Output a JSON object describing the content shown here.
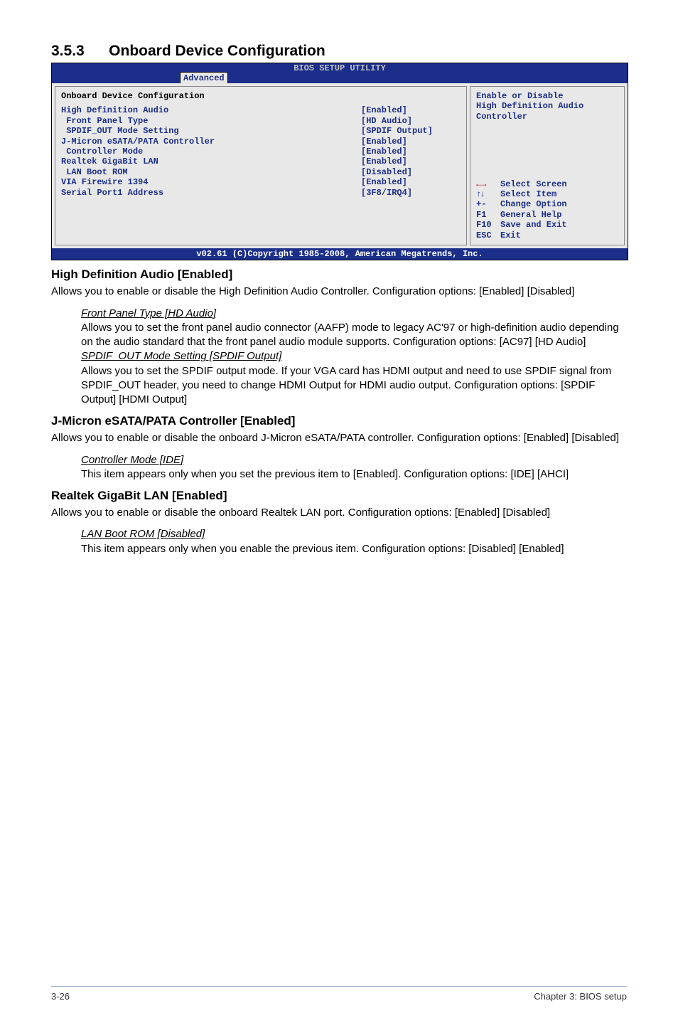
{
  "section": {
    "number": "3.5.3",
    "title": "Onboard Device Configuration"
  },
  "bios": {
    "headerTitle": "BIOS SETUP UTILITY",
    "tab": "Advanced",
    "leftHeading": "Onboard Device Configuration",
    "rows": [
      {
        "k": "High Definition Audio",
        "v": "[Enabled]"
      },
      {
        "k": " Front Panel Type",
        "v": "[HD Audio]"
      },
      {
        "k": " SPDIF_OUT Mode Setting",
        "v": "[SPDIF Output]"
      },
      {
        "k": "J-Micron eSATA/PATA Controller",
        "v": "[Enabled]"
      },
      {
        "k": " Controller Mode",
        "v": "[Enabled]"
      },
      {
        "k": "Realtek GigaBit LAN",
        "v": "[Enabled]"
      },
      {
        "k": " LAN Boot ROM",
        "v": "[Disabled]"
      },
      {
        "k": "VIA Firewire 1394",
        "v": "[Enabled]"
      },
      {
        "k": "",
        "v": ""
      },
      {
        "k": "Serial Port1 Address",
        "v": "[3F8/IRQ4]"
      }
    ],
    "helpTop1": "Enable or Disable",
    "helpTop2": "High Definition Audio",
    "helpTop3": "Controller",
    "helpLines": [
      {
        "sym": "lr",
        "txt": "Select Screen"
      },
      {
        "sym": "ud",
        "txt": "Select Item"
      },
      {
        "sym": "+-",
        "txt": "Change Option"
      },
      {
        "sym": "F1",
        "txt": "General Help"
      },
      {
        "sym": "F10",
        "txt": "Save and Exit"
      },
      {
        "sym": "ESC",
        "txt": "Exit"
      }
    ],
    "footer": "v02.61 (C)Copyright 1985-2008, American Megatrends, Inc."
  },
  "body": {
    "h1": "High Definition Audio [Enabled]",
    "p1": "Allows you to enable or disable the High Definition Audio Controller. Configuration options: [Enabled] [Disabled]",
    "sub1_t": "Front Panel Type [HD Audio]",
    "sub1_p": "Allows you to set the front panel audio connector (AAFP) mode to legacy AC'97 or high-definition audio depending on the audio standard that the front panel audio module supports. Configuration options: [AC97] [HD Audio]",
    "sub2_t": "SPDIF_OUT Mode Setting [SPDIF Output]",
    "sub2_p": "Allows you to set the SPDIF output mode. If your VGA card has HDMI output and need to use SPDIF signal from SPDIF_OUT header, you need to change HDMI Output for HDMI audio output. Configuration options: [SPDIF Output] [HDMI Output]",
    "h2": "J-Micron eSATA/PATA Controller [Enabled]",
    "p2": "Allows you to enable or disable the onboard J-Micron eSATA/PATA controller. Configuration options: [Enabled] [Disabled]",
    "sub3_t": "Controller Mode [IDE]",
    "sub3_p": "This item appears only when you set the previous item to [Enabled]. Configuration options: [IDE] [AHCI]",
    "h3": "Realtek GigaBit LAN [Enabled]",
    "p3": "Allows you to enable or disable the onboard Realtek LAN port. Configuration options: [Enabled] [Disabled]",
    "sub4_t": "LAN Boot ROM [Disabled]",
    "sub4_p": "This item appears only when you enable the previous item. Configuration options: [Disabled] [Enabled]"
  },
  "pageFooter": {
    "left": "3-26",
    "right": "Chapter 3: BIOS setup"
  }
}
